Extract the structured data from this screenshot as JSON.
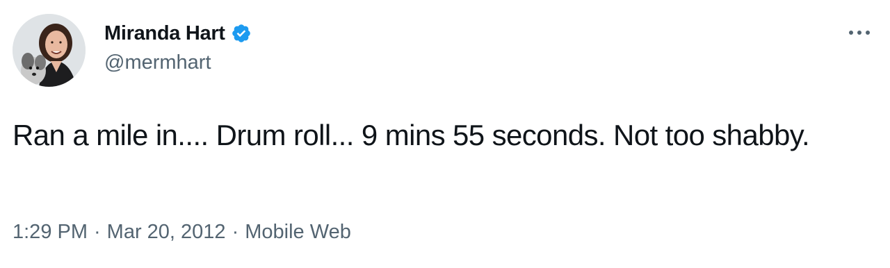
{
  "author": {
    "display_name": "Miranda Hart",
    "handle": "@mermhart",
    "verified_icon": "verified-badge-icon",
    "avatar_icon": "profile-photo"
  },
  "tweet": {
    "text": "Ran a mile in.... Drum roll... 9 mins 55 seconds. Not too shabby.",
    "time": "1:29 PM",
    "separator": "·",
    "date": "Mar 20, 2012",
    "source": "Mobile Web"
  },
  "colors": {
    "text_primary": "#0f1419",
    "text_secondary": "#536471",
    "verified_blue": "#1d9bf0"
  },
  "more_menu_icon": "more-horizontal-icon"
}
